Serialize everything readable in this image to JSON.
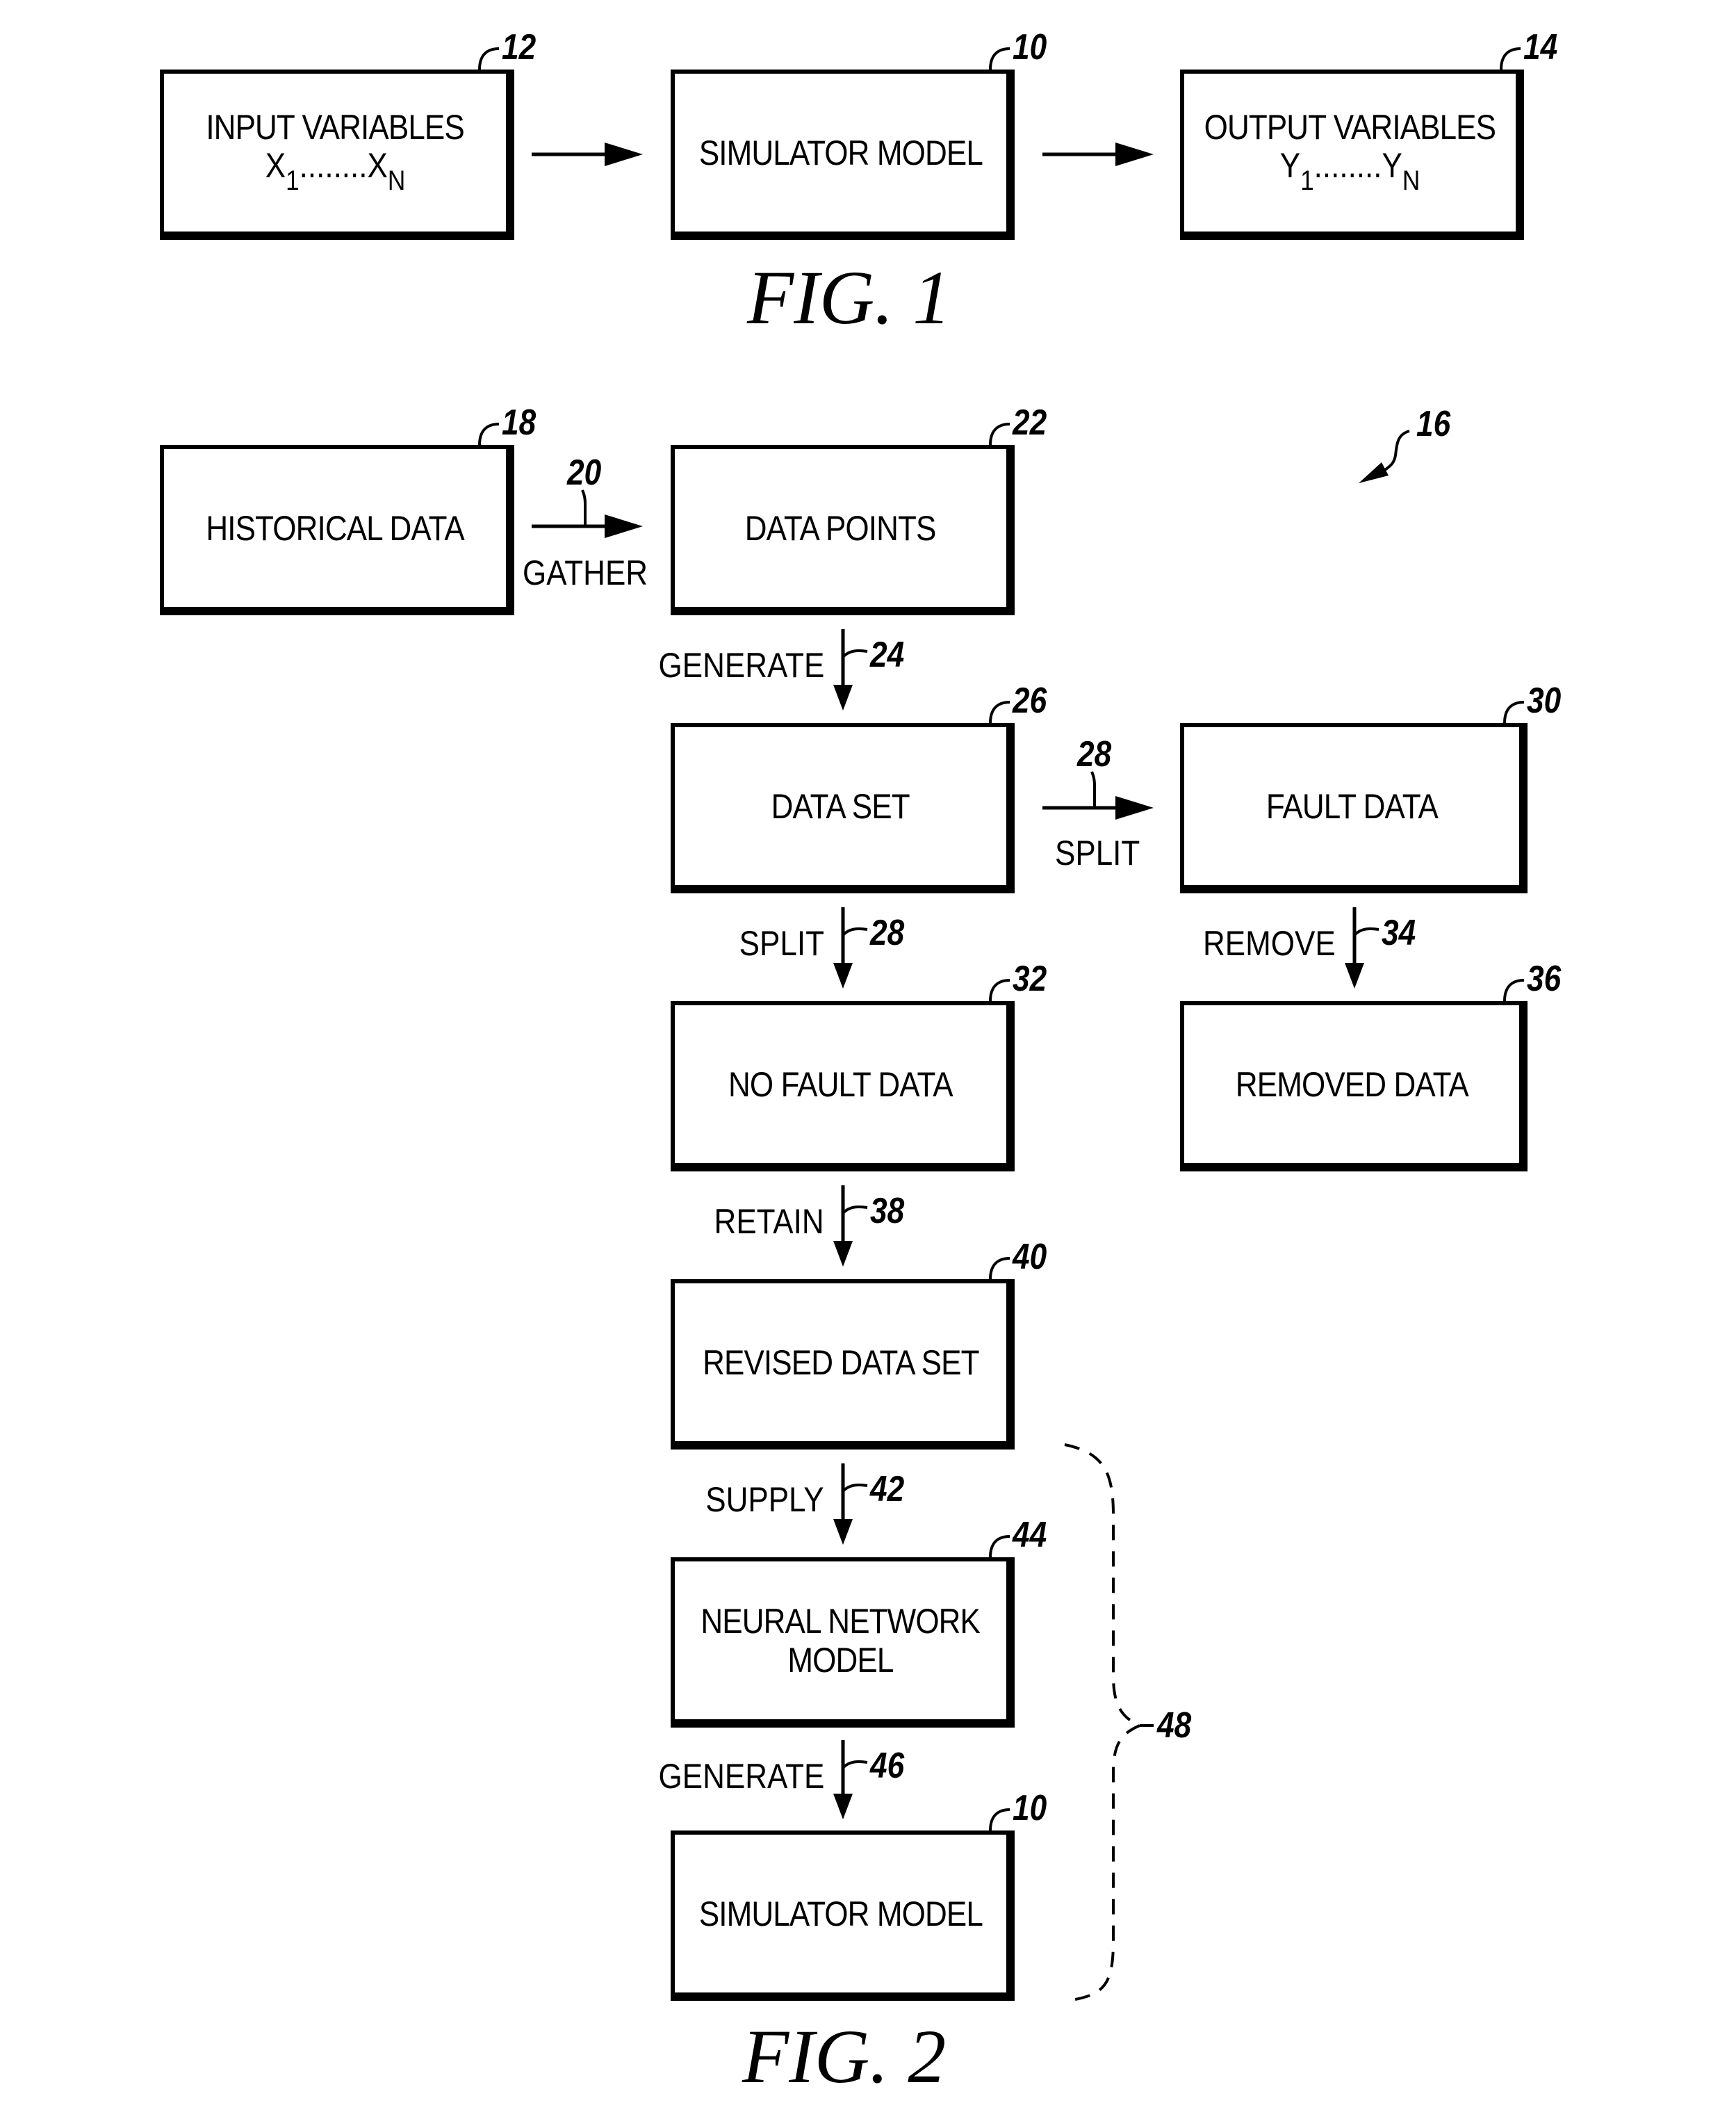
{
  "figure1": {
    "caption": "FIG. 1",
    "boxes": [
      {
        "ref": "12",
        "label": "INPUT VARIABLES",
        "sub_start": "X",
        "sub_start_idx": "1",
        "dots": "........",
        "sub_end": "X",
        "sub_end_idx": "N"
      },
      {
        "ref": "10",
        "label": "SIMULATOR MODEL"
      },
      {
        "ref": "14",
        "label": "OUTPUT VARIABLES",
        "sub_start": "Y",
        "sub_start_idx": "1",
        "dots": "........",
        "sub_end": "Y",
        "sub_end_idx": "N"
      }
    ]
  },
  "figure2": {
    "caption": "FIG. 2",
    "overall_ref": "16",
    "bracket_ref": "48",
    "boxes": {
      "historical": {
        "ref": "18",
        "label": "HISTORICAL DATA"
      },
      "data_points": {
        "ref": "22",
        "label": "DATA POINTS"
      },
      "data_set": {
        "ref": "26",
        "label": "DATA SET"
      },
      "fault_data": {
        "ref": "30",
        "label": "FAULT DATA"
      },
      "no_fault_data": {
        "ref": "32",
        "label": "NO FAULT DATA"
      },
      "removed_data": {
        "ref": "36",
        "label": "REMOVED DATA"
      },
      "revised_data_set": {
        "ref": "40",
        "label": "REVISED DATA SET"
      },
      "neural_network": {
        "ref": "44",
        "label_line1": "NEURAL NETWORK",
        "label_line2": "MODEL"
      },
      "simulator_model": {
        "ref": "10",
        "label": "SIMULATOR MODEL"
      }
    },
    "steps": {
      "gather": {
        "ref": "20",
        "label": "GATHER"
      },
      "generate1": {
        "ref": "24",
        "label": "GENERATE"
      },
      "split_right": {
        "ref": "28",
        "label": "SPLIT"
      },
      "split_down": {
        "ref": "28",
        "label": "SPLIT"
      },
      "remove": {
        "ref": "34",
        "label": "REMOVE"
      },
      "retain": {
        "ref": "38",
        "label": "RETAIN"
      },
      "supply": {
        "ref": "42",
        "label": "SUPPLY"
      },
      "generate2": {
        "ref": "46",
        "label": "GENERATE"
      }
    }
  }
}
